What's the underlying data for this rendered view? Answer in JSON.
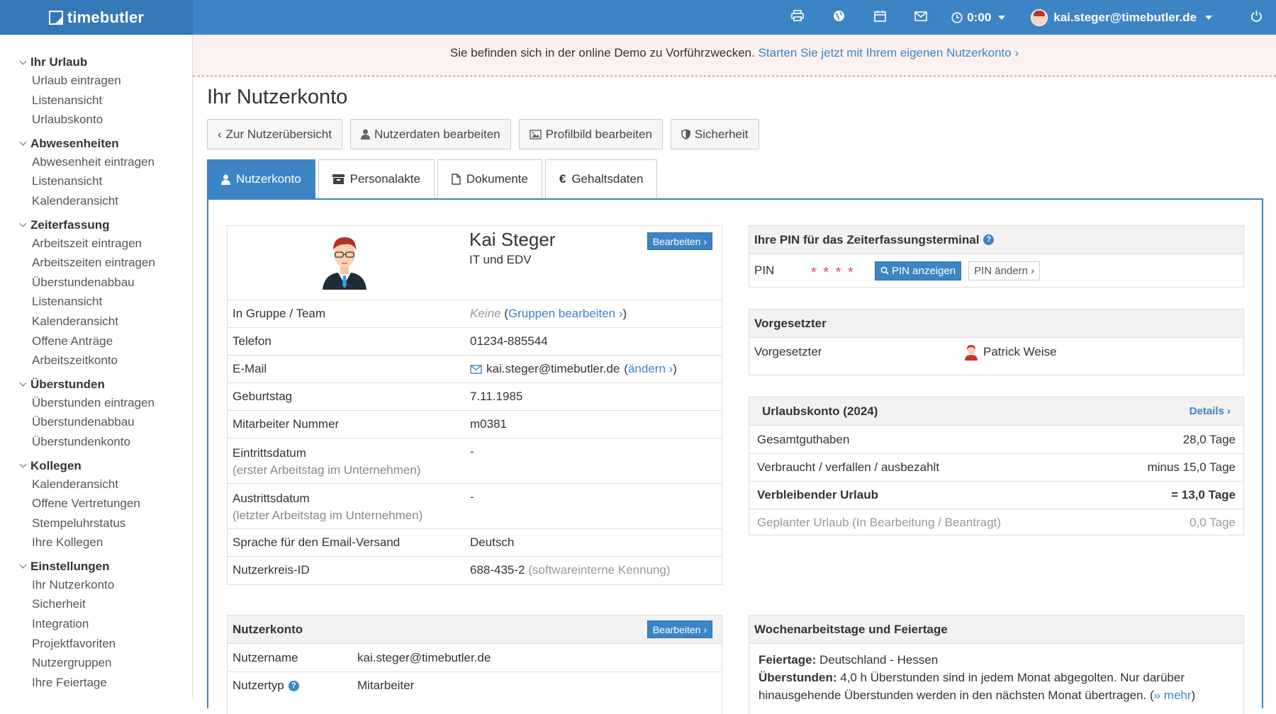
{
  "app": {
    "logo": "timebutler"
  },
  "topbar": {
    "time": "0:00",
    "user": "kai.steger@timebutler.de",
    "icons": [
      "print-icon",
      "globe-icon",
      "calendar-icon",
      "mail-icon",
      "clock-icon",
      "power-icon"
    ]
  },
  "banner": {
    "text": "Sie befinden sich in der online Demo zu Vorführzwecken.",
    "link": "Starten Sie jetzt mit Ihrem eigenen Nutzerkonto ›"
  },
  "sidebar": [
    {
      "title": "Ihr Urlaub",
      "items": [
        "Urlaub eintragen",
        "Listenansicht",
        "Urlaubskonto"
      ]
    },
    {
      "title": "Abwesenheiten",
      "items": [
        "Abwesenheit eintragen",
        "Listenansicht",
        "Kalenderansicht"
      ]
    },
    {
      "title": "Zeiterfassung",
      "items": [
        "Arbeitszeit eintragen",
        "Arbeitszeiten eintragen",
        "Überstundenabbau",
        "Listenansicht",
        "Kalenderansicht",
        "Offene Anträge",
        "Arbeitszeitkonto"
      ]
    },
    {
      "title": "Überstunden",
      "items": [
        "Überstunden eintragen",
        "Überstundenabbau",
        "Überstundenkonto"
      ]
    },
    {
      "title": "Kollegen",
      "items": [
        "Kalenderansicht",
        "Offene Vertretungen",
        "Stempeluhrstatus",
        "Ihre Kollegen"
      ]
    },
    {
      "title": "Einstellungen",
      "items": [
        "Ihr Nutzerkonto",
        "Sicherheit",
        "Integration",
        "Projektfavoriten",
        "Nutzergruppen",
        "Ihre Feiertage"
      ]
    }
  ],
  "page": {
    "title": "Ihr Nutzerkonto"
  },
  "buttons": {
    "back": "Zur Nutzerübersicht",
    "edit_user": "Nutzerdaten bearbeiten",
    "edit_picture": "Profilbild bearbeiten",
    "security": "Sicherheit"
  },
  "tabs": [
    "Nutzerkonto",
    "Personalakte",
    "Dokumente",
    "Gehaltsdaten"
  ],
  "profile": {
    "name": "Kai Steger",
    "department": "IT und EDV",
    "edit": "Bearbeiten ›",
    "group_label": "In Gruppe / Team",
    "group_value": "Keine",
    "group_link": "Gruppen bearbeiten ›",
    "phone_label": "Telefon",
    "phone": "01234-885544",
    "email_label": "E-Mail",
    "email": "kai.steger@timebutler.de",
    "email_change": "ändern ›",
    "birthday_label": "Geburtstag",
    "birthday": "7.11.1985",
    "empno_label": "Mitarbeiter Nummer",
    "empno": "m0381",
    "entry_label": "Eintrittsdatum",
    "entry_sub": "(erster Arbeitstag im Unternehmen)",
    "entry": "-",
    "exit_label": "Austrittsdatum",
    "exit_sub": "(letzter Arbeitstag im Unternehmen)",
    "exit": "-",
    "lang_label": "Sprache für den Email-Versand",
    "lang": "Deutsch",
    "circle_label": "Nutzerkreis-ID",
    "circle": "688-435-2",
    "circle_note": "(softwareinterne Kennung)"
  },
  "account": {
    "title": "Nutzerkonto",
    "edit": "Bearbeiten ›",
    "username_label": "Nutzername",
    "username": "kai.steger@timebutler.de",
    "type_label": "Nutzertyp",
    "type": "Mitarbeiter"
  },
  "pin": {
    "title": "Ihre PIN für das Zeiterfassungsterminal",
    "label": "PIN",
    "masked": "* * * *",
    "show": "PIN anzeigen",
    "change": "PIN ändern ›"
  },
  "supervisor": {
    "title": "Vorgesetzter",
    "label": "Vorgesetzter",
    "name": "Patrick Weise"
  },
  "vacation": {
    "title": "Urlaubskonto (2024)",
    "details": "Details ›",
    "rows": [
      {
        "label": "Gesamtguthaben",
        "value": "28,0 Tage"
      },
      {
        "label": "Verbraucht / verfallen / ausbezahlt",
        "value": "minus 15,0 Tage"
      },
      {
        "label": "Verbleibender Urlaub",
        "value": "= 13,0 Tage"
      },
      {
        "label": "Geplanter Urlaub (In Bearbeitung / Beantragt)",
        "value": "0,0 Tage"
      }
    ]
  },
  "workdays": {
    "title": "Wochenarbeitstage und Feiertage",
    "holidays_label": "Feiertage:",
    "holidays": "Deutschland - Hessen",
    "overtime_label": "Überstunden:",
    "overtime": "4,0 h Überstunden sind in jedem Monat abgegolten. Nur darüber",
    "overtime2": "hinausgehende Überstunden werden in den nächsten Monat übertragen.",
    "more": "» mehr"
  }
}
